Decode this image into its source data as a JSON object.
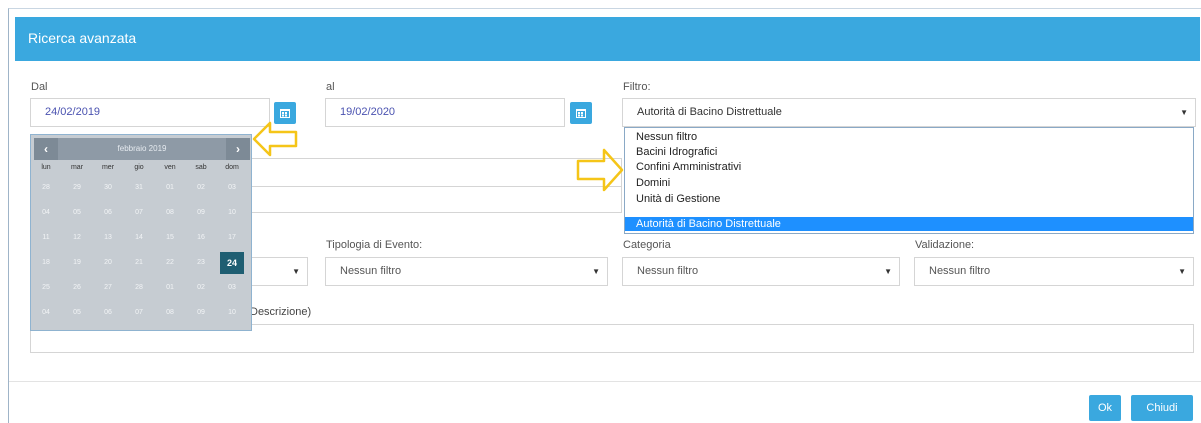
{
  "header": {
    "title": "Ricerca avanzata"
  },
  "date_from": {
    "label": "Dal",
    "value": "24/02/2019"
  },
  "date_to": {
    "label": "al",
    "value": "19/02/2020"
  },
  "filter": {
    "label": "Filtro:",
    "selected": "Autorità di Bacino Distrettuale",
    "options": [
      "Nessun filtro",
      "Bacini Idrografici",
      "Confini Amministrativi",
      "Domini",
      "Unità di Gestione",
      "Autorità di Bacino Distrettuale"
    ]
  },
  "calendar": {
    "month_label": "febbraio 2019",
    "prev_icon": "chevron-left-icon",
    "next_icon": "chevron-right-icon",
    "weekdays": [
      "lun",
      "mar",
      "mer",
      "gio",
      "ven",
      "sab",
      "dom"
    ],
    "weeks": [
      [
        "28",
        "29",
        "30",
        "31",
        "01",
        "02",
        "03"
      ],
      [
        "04",
        "05",
        "06",
        "07",
        "08",
        "09",
        "10"
      ],
      [
        "11",
        "12",
        "13",
        "14",
        "15",
        "16",
        "17"
      ],
      [
        "18",
        "19",
        "20",
        "21",
        "22",
        "23",
        "24"
      ],
      [
        "25",
        "26",
        "27",
        "28",
        "01",
        "02",
        "03"
      ],
      [
        "04",
        "05",
        "06",
        "07",
        "08",
        "09",
        "10"
      ]
    ],
    "selected_day": "24"
  },
  "event_type": {
    "label": "Tipologia di Evento:",
    "value": "Nessun filtro"
  },
  "category": {
    "label": "Categoria",
    "value": "Nessun filtro"
  },
  "validation": {
    "label": "Validazione:",
    "value": "Nessun filtro"
  },
  "description": {
    "label_fragment": "Descrizione)"
  },
  "buttons": {
    "ok": "Ok",
    "close": "Chiudi"
  },
  "colors": {
    "accent": "#3aa8df",
    "selected_option": "#1e90ff",
    "arrow": "#f5c518"
  }
}
